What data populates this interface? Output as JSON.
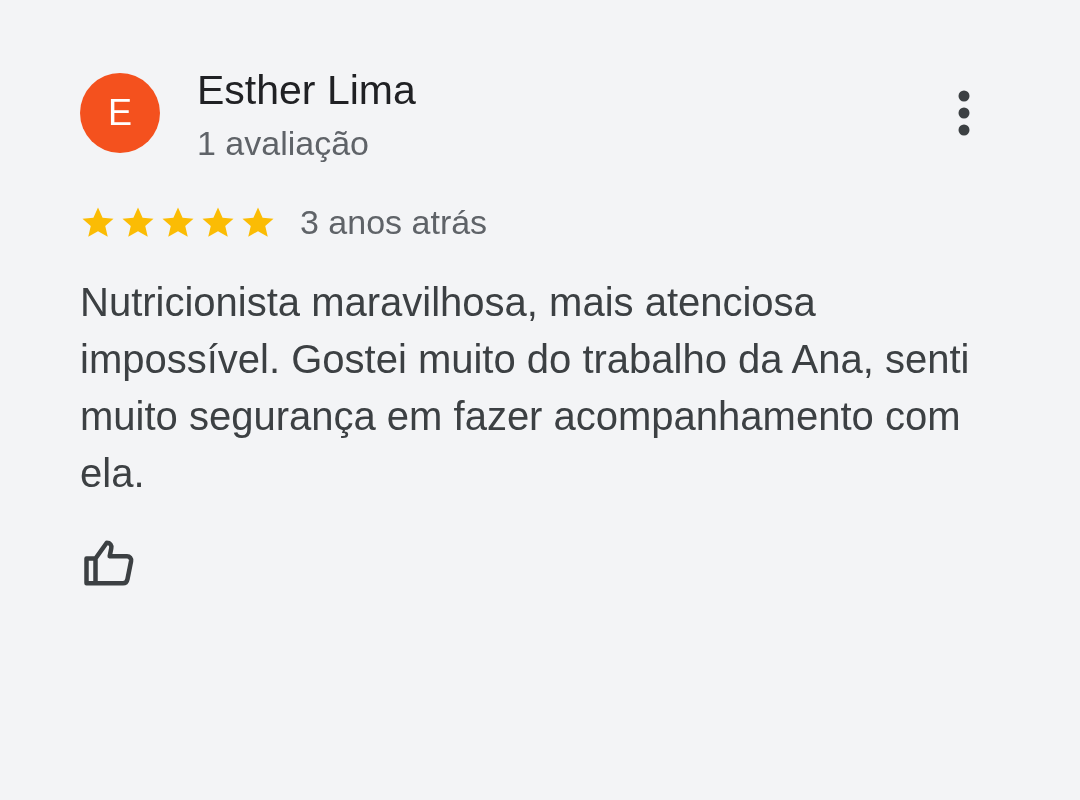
{
  "review": {
    "avatar_letter": "E",
    "name": "Esther Lima",
    "review_count": "1 avaliação",
    "stars": 5,
    "time": "3 anos atrás",
    "text": "Nutricionista maravilhosa, mais atenciosa impossível. Gostei muito do trabalho da Ana, senti muito segurança em fazer acompanhamento com ela."
  }
}
